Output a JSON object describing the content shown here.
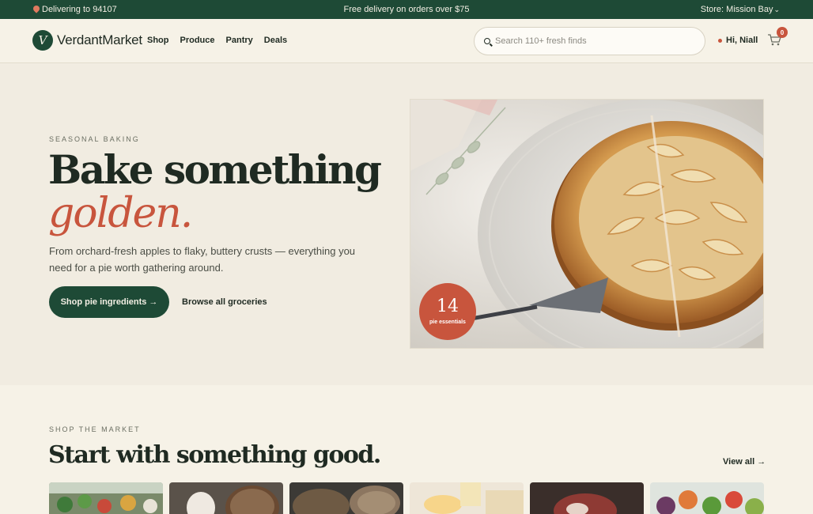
{
  "topbar": {
    "delivery_text": "Delivering to 94107",
    "promo_text": "Free delivery on orders over $75",
    "store_text": "Store: Mission Bay"
  },
  "header": {
    "logo_letter": "V",
    "brand_name": "VerdantMarket",
    "nav": [
      {
        "label": "Shop"
      },
      {
        "label": "Produce"
      },
      {
        "label": "Pantry"
      },
      {
        "label": "Deals"
      }
    ],
    "search_placeholder": "Search 110+ fresh finds",
    "search_value": "",
    "greeting": "Hi, Niall",
    "cart_count": "0"
  },
  "hero": {
    "eyebrow": "SEASONAL BAKING",
    "headline": "Bake something",
    "headline_accent": "golden.",
    "body": "From orchard-fresh apples to flaky, buttery crusts — everything you need for a pie worth gathering around.",
    "primary_cta": "Shop pie ingredients →",
    "secondary_cta": "Browse all groceries",
    "badge_number": "14",
    "badge_label": "pie essentials"
  },
  "market": {
    "eyebrow": "SHOP THE MARKET",
    "title": "Start with something good.",
    "view_all": "View all →"
  },
  "icons": {
    "location": "pin-icon",
    "store_dropdown": "chevron-down-icon",
    "search": "search-icon",
    "cart": "cart-icon"
  },
  "colors": {
    "brand_green": "#1e4a36",
    "accent_terracotta": "#c8553d",
    "background_cream": "#f3efe4"
  }
}
